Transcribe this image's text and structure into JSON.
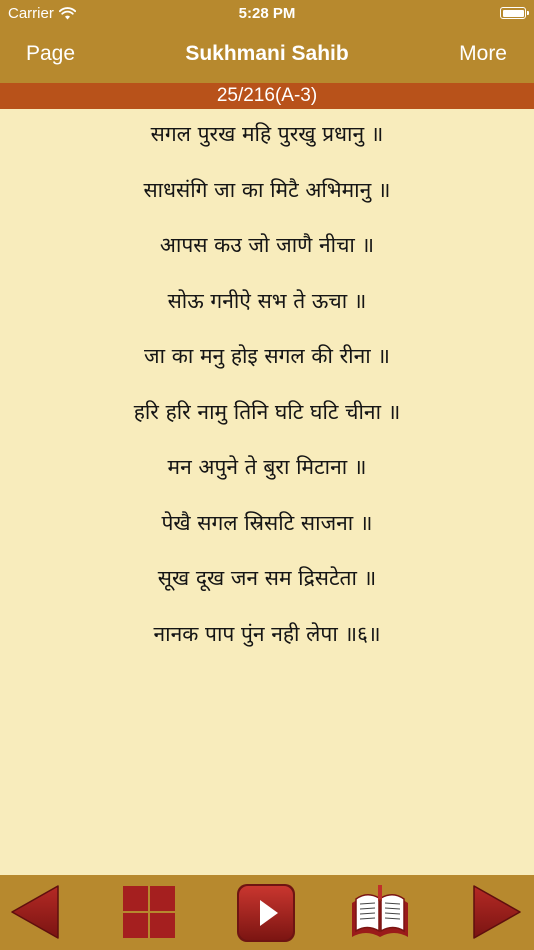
{
  "status": {
    "carrier": "Carrier",
    "time": "5:28 PM"
  },
  "nav": {
    "left_label": "Page",
    "title": "Sukhmani Sahib",
    "right_label": "More"
  },
  "page_indicator": "25/216(A-3)",
  "verses": [
    "सगल पुरख महि पुरखु प्रधानु ॥",
    "साधसंगि जा का मिटै अभिमानु ॥",
    "आपस कउ जो जाणै नीचा ॥",
    "सोऊ गनीऐ सभ ते ऊचा ॥",
    "जा का मनु होइ सगल की रीना ॥",
    "हरि हरि नामु तिनि घटि घटि चीना ॥",
    "मन अपुने ते बुरा मिटाना ॥",
    "पेखै सगल स्रिसटि साजना ॥",
    "सूख दूख जन सम द्रिसटेता ॥",
    "नानक पाप पुंन नही लेपा ॥६॥"
  ],
  "icons": {
    "prev": "previous-arrow-icon",
    "grid": "grid-index-icon",
    "play": "play-icon",
    "book": "book-icon",
    "next": "next-arrow-icon"
  },
  "colors": {
    "header": "#b7892e",
    "page_bar": "#b8521a",
    "background": "#f8ecbc",
    "toolbar_icon_red": "#a01f1f"
  }
}
